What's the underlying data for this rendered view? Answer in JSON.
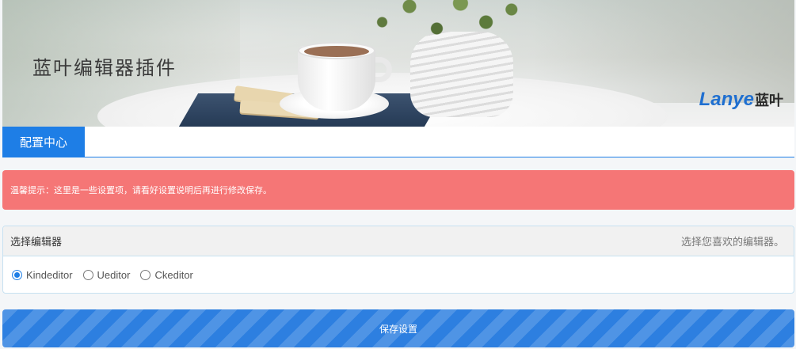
{
  "banner": {
    "title": "蓝叶编辑器插件",
    "logo_latin": "Lanye",
    "logo_cn": "蓝叶"
  },
  "tabs": [
    {
      "label": "配置中心",
      "active": true
    }
  ],
  "alert": {
    "text": "温馨提示：这里是一些设置项，请看好设置说明后再进行修改保存。"
  },
  "editor_panel": {
    "title": "选择编辑器",
    "hint": "选择您喜欢的编辑器。",
    "options": [
      {
        "label": "Kindeditor",
        "checked": true
      },
      {
        "label": "Ueditor",
        "checked": false
      },
      {
        "label": "Ckeditor",
        "checked": false
      }
    ]
  },
  "save_label": "保存设置",
  "colors": {
    "accent": "#1e7ee6",
    "alert_bg": "#f57676",
    "save_bg": "#2d7fe0"
  }
}
